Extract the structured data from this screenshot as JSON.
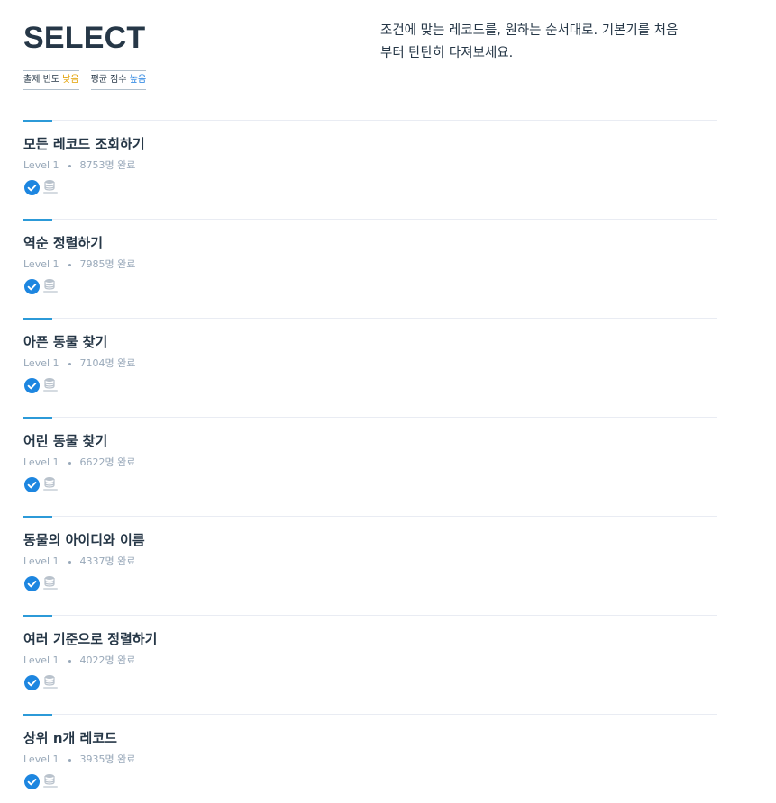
{
  "kit": {
    "title": "SELECT",
    "description": "조건에 맞는 레코드를, 원하는 순서대로. 기본기를 처음부터 탄탄히 다져보세요.",
    "badges": [
      {
        "label": "출제 빈도",
        "value": "낮음",
        "value_color": "#e2a000"
      },
      {
        "label": "평균 점수",
        "value": "높음",
        "value_color": "#1d7ee0"
      }
    ]
  },
  "colors": {
    "accent": "#2c9ad8",
    "title_text": "#263747",
    "meta_text": "#98a8b9",
    "check": "#1d86e0"
  },
  "problems": [
    {
      "title": "모든 레코드 조회하기",
      "level": "Level 1",
      "completed": "8753명 완료",
      "icons": [
        "check-circle-icon",
        "database-icon"
      ]
    },
    {
      "title": "역순 정렬하기",
      "level": "Level 1",
      "completed": "7985명 완료",
      "icons": [
        "check-circle-icon",
        "database-icon"
      ]
    },
    {
      "title": "아픈 동물 찾기",
      "level": "Level 1",
      "completed": "7104명 완료",
      "icons": [
        "check-circle-icon",
        "database-icon"
      ]
    },
    {
      "title": "어린 동물 찾기",
      "level": "Level 1",
      "completed": "6622명 완료",
      "icons": [
        "check-circle-icon",
        "database-icon"
      ]
    },
    {
      "title": "동물의 아이디와 이름",
      "level": "Level 1",
      "completed": "4337명 완료",
      "icons": [
        "check-circle-icon",
        "database-icon"
      ]
    },
    {
      "title": "여러 기준으로 정렬하기",
      "level": "Level 1",
      "completed": "4022명 완료",
      "icons": [
        "check-circle-icon",
        "database-icon"
      ]
    },
    {
      "title": "상위 n개 레코드",
      "level": "Level 1",
      "completed": "3935명 완료",
      "icons": [
        "check-circle-icon",
        "database-icon"
      ]
    }
  ]
}
